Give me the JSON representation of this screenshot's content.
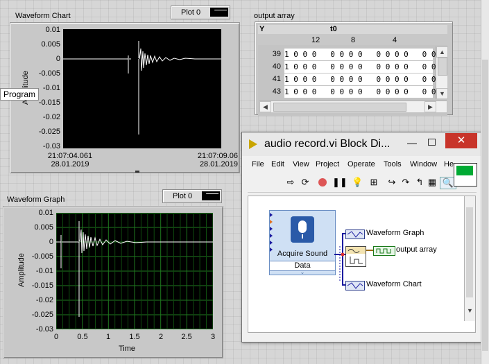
{
  "waveform_chart": {
    "label": "Waveform Chart",
    "plot_legend": "Plot 0",
    "y_axis_label": "Amplitude",
    "y_ticks": [
      "0.01",
      "0.005",
      "0",
      "-0.005",
      "-0.01",
      "-0.015",
      "-0.02",
      "-0.025",
      "-0.03"
    ],
    "x_start_time": "21:07:04.061",
    "x_start_date": "28.01.2019",
    "x_end_time": "21:07:09.06",
    "x_end_date": "28.01.2019"
  },
  "tooltip": "Program",
  "waveform_graph": {
    "label": "Waveform Graph",
    "plot_legend": "Plot 0",
    "y_axis_label": "Amplitude",
    "x_axis_label": "Time",
    "y_ticks": [
      "0.01",
      "0.005",
      "0",
      "-0.005",
      "-0.01",
      "-0.015",
      "-0.02",
      "-0.025",
      "-0.03"
    ],
    "x_ticks": [
      "0",
      "0.5",
      "1",
      "1.5",
      "2",
      "2.5",
      "3"
    ]
  },
  "output_array": {
    "label": "output array",
    "header_y": "Y",
    "header_t0": "t0",
    "col_labels": [
      "12",
      "8",
      "4"
    ],
    "rows": [
      {
        "index": "39",
        "cells": "1 0 0 0   0 0 0 0   0 0 0 0   0 0 0"
      },
      {
        "index": "40",
        "cells": "1 0 0 0   0 0 0 0   0 0 0 0   0 0 0"
      },
      {
        "index": "41",
        "cells": "1 0 0 0   0 0 0 0   0 0 0 0   0 0 0"
      },
      {
        "index": "43",
        "cells": "1 0 0 0   0 0 0 0   0 0 0 0   0 0 0"
      }
    ]
  },
  "block_diagram": {
    "title": "audio record.vi Block Di...",
    "menu": [
      "File",
      "Edit",
      "View",
      "Project",
      "Operate",
      "Tools",
      "Window",
      "He"
    ],
    "nodes": {
      "acquire_sound": "Acquire Sound",
      "acquire_data": "Data",
      "graph_terminal": "Waveform Graph",
      "array_terminal": "output array",
      "chart_terminal": "Waveform Chart"
    }
  },
  "colors": {
    "plot_bg": "#000000",
    "grid": "#1f7a1f",
    "trace": "#ffffff",
    "wire_dynamic": "#1a1aa0",
    "wire_waveform": "#9a6a10",
    "close_red": "#c8342a"
  }
}
